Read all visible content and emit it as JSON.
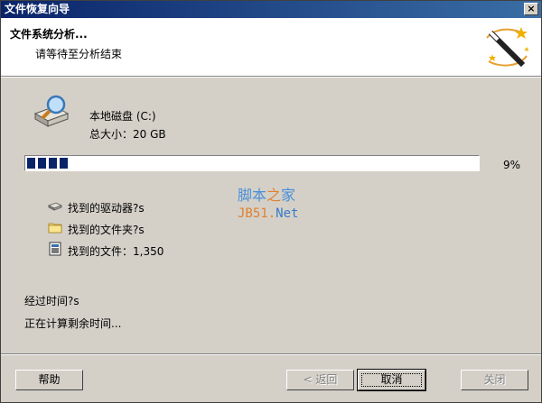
{
  "window": {
    "title": "文件恢复向导",
    "close_label": "×"
  },
  "header": {
    "title": "文件系统分析...",
    "subtitle": "请等待至分析结束"
  },
  "drive": {
    "name": "本地磁盘 (C:)",
    "size": "总大小：20 GB"
  },
  "progress": {
    "percent_label": "9%",
    "value": 0.09
  },
  "found": {
    "drives": "找到的驱动器?s",
    "folders": "找到的文件夹?s",
    "files": "找到的文件：1,350"
  },
  "watermark": {
    "line1_a": "脚本",
    "line1_b": "之",
    "line1_c": "家",
    "line2_a": "JB51.",
    "line2_b": "Net"
  },
  "status": {
    "elapsed": "经过时间?s",
    "remaining": "正在计算剩余时间..."
  },
  "buttons": {
    "help": "帮助",
    "back": "< 返回",
    "cancel": "取消",
    "close": "关闭"
  },
  "colors": {
    "title_bar": "#0a246a",
    "progress": "#0a246a",
    "face": "#d4d0c8"
  }
}
